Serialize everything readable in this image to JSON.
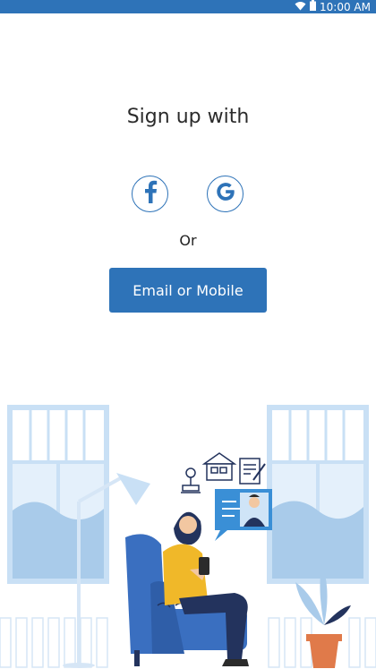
{
  "status_bar": {
    "time": "10:00 AM",
    "icons": [
      "wifi-icon",
      "battery-icon"
    ],
    "background": "#2e73b8"
  },
  "signup": {
    "title": "Sign up with",
    "social": [
      {
        "name": "facebook",
        "glyph": "f",
        "icon": "facebook-icon"
      },
      {
        "name": "google",
        "glyph": "G",
        "icon": "google-icon"
      }
    ],
    "or_text": "Or",
    "email_button": "Email or Mobile"
  },
  "colors": {
    "accent": "#2e73b8",
    "illustration_light": "#c9e0f5",
    "chair": "#3a6fc0",
    "sweater": "#f0b829",
    "pants": "#23335d",
    "pot": "#e07a4a"
  }
}
